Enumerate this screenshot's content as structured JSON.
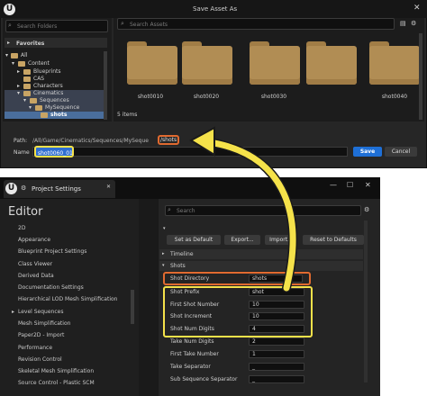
{
  "save_dialog": {
    "title": "Save Asset As",
    "close_glyph": "✕",
    "logo": "U",
    "folders_search_placeholder": "Search Folders",
    "favorites_label": "Favorites",
    "tree": [
      {
        "label": "All"
      },
      {
        "label": "Content"
      },
      {
        "label": "Blueprints"
      },
      {
        "label": "CAS"
      },
      {
        "label": "Characters"
      },
      {
        "label": "Cinematics"
      },
      {
        "label": "Sequences"
      },
      {
        "label": "MySequence"
      },
      {
        "label": "shots"
      }
    ],
    "assets_search_placeholder": "Search Assets",
    "assets": [
      "shot0010",
      "shot0020",
      "shot0030",
      "shot0040"
    ],
    "items_count": "5 items",
    "path_label": "Path:",
    "path_value": "/All/Game/Cinematics/Sequences/MySeque",
    "path_highlight": "/shots",
    "name_label": "Name",
    "name_value": "shot0060_01",
    "save_label": "Save",
    "cancel_label": "Cancel"
  },
  "project_settings": {
    "logo": "U",
    "tab_title": "Project Settings",
    "tab_close": "✕",
    "win_minimize": "—",
    "win_maximize": "☐",
    "win_close": "✕",
    "editor_title": "Editor",
    "sidebar_items": [
      "2D",
      "Appearance",
      "Blueprint Project Settings",
      "Class Viewer",
      "Derived Data",
      "Documentation Settings",
      "Hierarchical LOD Mesh Simplification",
      "Level Sequences",
      "Mesh Simplification",
      "Paper2D - Import",
      "Performance",
      "Revision Control",
      "Skeletal Mesh Simplification",
      "Source Control - Plastic SCM"
    ],
    "search_placeholder": "Search",
    "buttons": {
      "set_default": "Set as Default",
      "export": "Export...",
      "import": "Import...",
      "reset": "Reset to Defaults"
    },
    "sections": {
      "timeline": "Timeline",
      "shots": "Shots"
    },
    "properties": [
      {
        "label": "Shot Directory",
        "value": "shots"
      },
      {
        "label": "Shot Prefix",
        "value": "shot"
      },
      {
        "label": "First Shot Number",
        "value": "10"
      },
      {
        "label": "Shot Increment",
        "value": "10"
      },
      {
        "label": "Shot Num Digits",
        "value": "4"
      },
      {
        "label": "Take Num Digits",
        "value": "2"
      },
      {
        "label": "First Take Number",
        "value": "1"
      },
      {
        "label": "Take Separator",
        "value": "_"
      },
      {
        "label": "Sub Sequence Separator",
        "value": "_"
      }
    ]
  },
  "colors": {
    "arrow_yellow": "#f5e24a",
    "highlight_orange": "#e06a30",
    "accent_blue": "#1e6fd6"
  }
}
